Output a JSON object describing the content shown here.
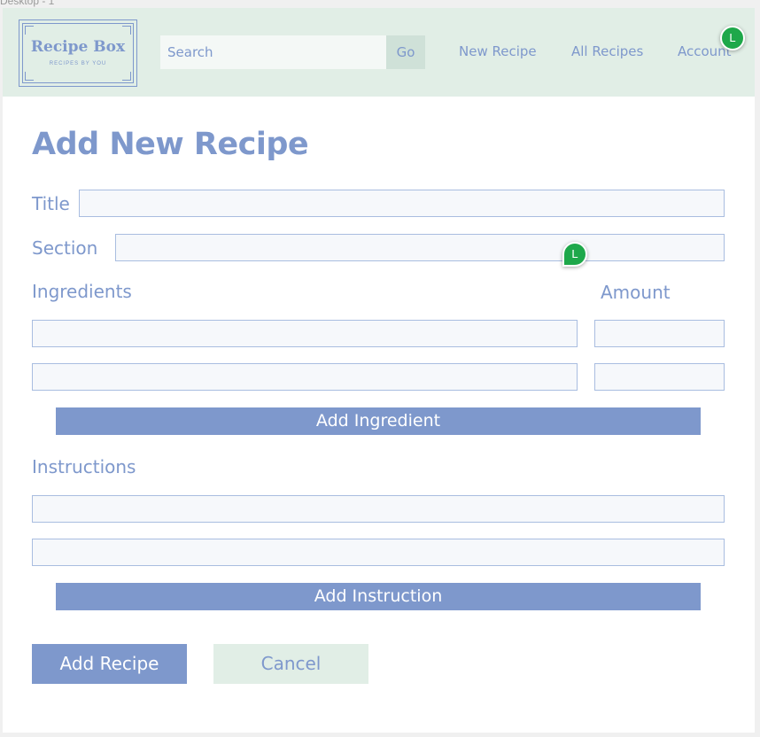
{
  "frame": {
    "label": "Desktop - 1"
  },
  "header": {
    "logo": {
      "title": "Recipe Box",
      "subtitle": "RECIPES BY YOU"
    },
    "search": {
      "placeholder": "Search",
      "button_label": "Go"
    },
    "nav": {
      "new_recipe": "New Recipe",
      "all_recipes": "All Recipes",
      "account": "Account"
    },
    "avatar_initial": "L"
  },
  "form": {
    "page_title": "Add New Recipe",
    "title_label": "Title",
    "section_label": "Section",
    "ingredients_label": "Ingredients",
    "amount_label": "Amount",
    "add_ingredient_label": "Add Ingredient",
    "instructions_label": "Instructions",
    "add_instruction_label": "Add Instruction",
    "submit_label": "Add Recipe",
    "cancel_label": "Cancel"
  },
  "cursor_avatar_initial": "L",
  "colors": {
    "accent": "#7e98cc",
    "header_bg": "#e1eee6",
    "avatar": "#1ea84a"
  }
}
